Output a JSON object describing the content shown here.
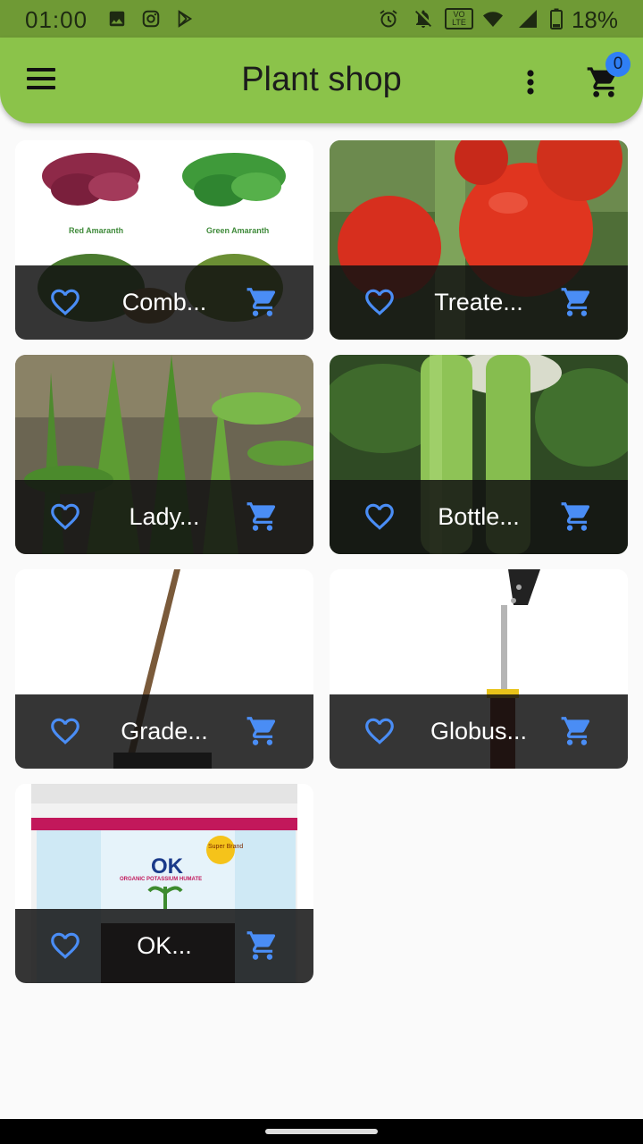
{
  "status_bar": {
    "time": "01:00",
    "battery": "18%",
    "icons": [
      "image-icon",
      "instagram-icon",
      "play-store-icon",
      "alarm-icon",
      "notifications-off-icon",
      "volte-icon",
      "wifi-icon",
      "signal-icon",
      "battery-icon"
    ],
    "volte_text": "VO LTE"
  },
  "app_bar": {
    "title": "Plant shop",
    "cart_count": "0",
    "icons": [
      "menu-icon",
      "more-vert-icon",
      "cart-icon"
    ]
  },
  "products": [
    {
      "name": "Comb...",
      "image": "amaranth-seeds-combo",
      "image_labels": [
        "Red Amaranth",
        "Green Amaranth"
      ]
    },
    {
      "name": "Treate...",
      "image": "tomato-plant"
    },
    {
      "name": "Lady...",
      "image": "ladyfinger-okra-plant"
    },
    {
      "name": "Bottle...",
      "image": "bottle-gourd-plant"
    },
    {
      "name": "Grade...",
      "image": "garden-hoe-tool"
    },
    {
      "name": "Globus...",
      "image": "globus-hand-tool"
    },
    {
      "name": "OK...",
      "image": "ok-potassium-humate-bucket",
      "image_labels": [
        "OK",
        "ORGANIC POTASSIUM HUMATE",
        "Super Brand"
      ]
    }
  ],
  "colors": {
    "status_bar": "#6f9a35",
    "app_bar": "#8bc34a",
    "accent_icon": "#4a8df5",
    "badge": "#2f7ff5",
    "card_bar": "#121212"
  }
}
